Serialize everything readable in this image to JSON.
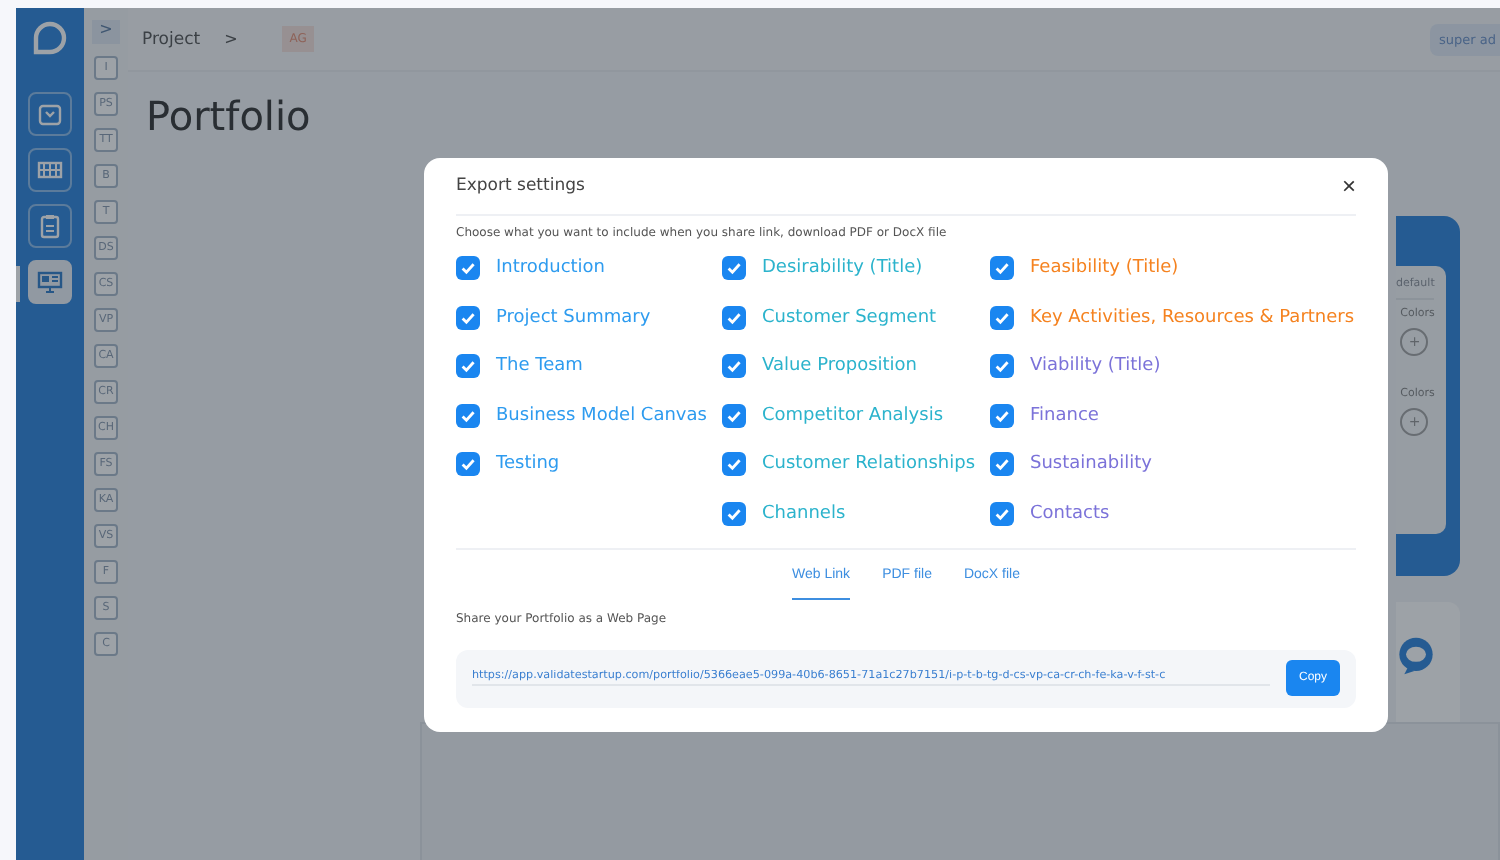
{
  "sidebar": {
    "items": [
      {
        "selected": false
      },
      {
        "selected": false
      },
      {
        "selected": false
      },
      {
        "selected": true
      }
    ]
  },
  "section_nav": {
    "toggle": ">",
    "items": [
      "I",
      "PS",
      "TT",
      "B",
      "T",
      "DS",
      "CS",
      "VP",
      "CA",
      "CR",
      "CH",
      "FS",
      "KA",
      "VS",
      "F",
      "S",
      "C"
    ]
  },
  "header": {
    "breadcrumb": "Project",
    "separator": ">",
    "avatar": "AG",
    "user_badge": "super ad"
  },
  "page": {
    "title": "Portfolio"
  },
  "background_card": {
    "label": "default",
    "color_labels": [
      "Colors",
      "Colors"
    ],
    "add_buttons": [
      "+",
      "+"
    ]
  },
  "modal": {
    "title": "Export settings",
    "close": "×",
    "subtitle": "Choose what you want to include when you share link, download PDF or DocX file",
    "columns": [
      [
        {
          "label": "Introduction",
          "checked": true,
          "color": "#2d9bef"
        },
        {
          "label": "Project Summary",
          "checked": true,
          "color": "#2d9bef"
        },
        {
          "label": "The Team",
          "checked": true,
          "color": "#2d9bef"
        },
        {
          "label": "Business Model Canvas",
          "checked": true,
          "color": "#2d9bef"
        },
        {
          "label": "Testing",
          "checked": true,
          "color": "#2d9bef"
        }
      ],
      [
        {
          "label": "Desirability (Title)",
          "checked": true,
          "color": "#2bb3cc"
        },
        {
          "label": "Customer Segment",
          "checked": true,
          "color": "#2bb3cc"
        },
        {
          "label": "Value Proposition",
          "checked": true,
          "color": "#2bb3cc"
        },
        {
          "label": "Competitor Analysis",
          "checked": true,
          "color": "#2bb3cc"
        },
        {
          "label": "Customer Relationships",
          "checked": true,
          "color": "#2bb3cc"
        },
        {
          "label": "Channels",
          "checked": true,
          "color": "#2bb3cc"
        }
      ],
      [
        {
          "label": "Feasibility (Title)",
          "checked": true,
          "color": "#f5821f"
        },
        {
          "label": "Key Activities, Resources & Partners",
          "checked": true,
          "color": "#f5821f"
        },
        {
          "label": "Viability (Title)",
          "checked": true,
          "color": "#7b72d9"
        },
        {
          "label": "Finance",
          "checked": true,
          "color": "#7b72d9"
        },
        {
          "label": "Sustainability",
          "checked": true,
          "color": "#7b72d9"
        },
        {
          "label": "Contacts",
          "checked": true,
          "color": "#7b72d9"
        }
      ]
    ],
    "tabs": [
      {
        "label": "Web Link",
        "selected": true
      },
      {
        "label": "PDF file",
        "selected": false
      },
      {
        "label": "DocX file",
        "selected": false
      }
    ],
    "share_caption": "Share your Portfolio as a Web Page",
    "link": "https://app.validatestartup.com/portfolio/5366eae5-099a-40b6-8651-71a1c27b7151/i-p-t-b-tg-d-cs-vp-ca-cr-ch-fe-ka-v-f-st-c",
    "copy_button": "Copy"
  }
}
